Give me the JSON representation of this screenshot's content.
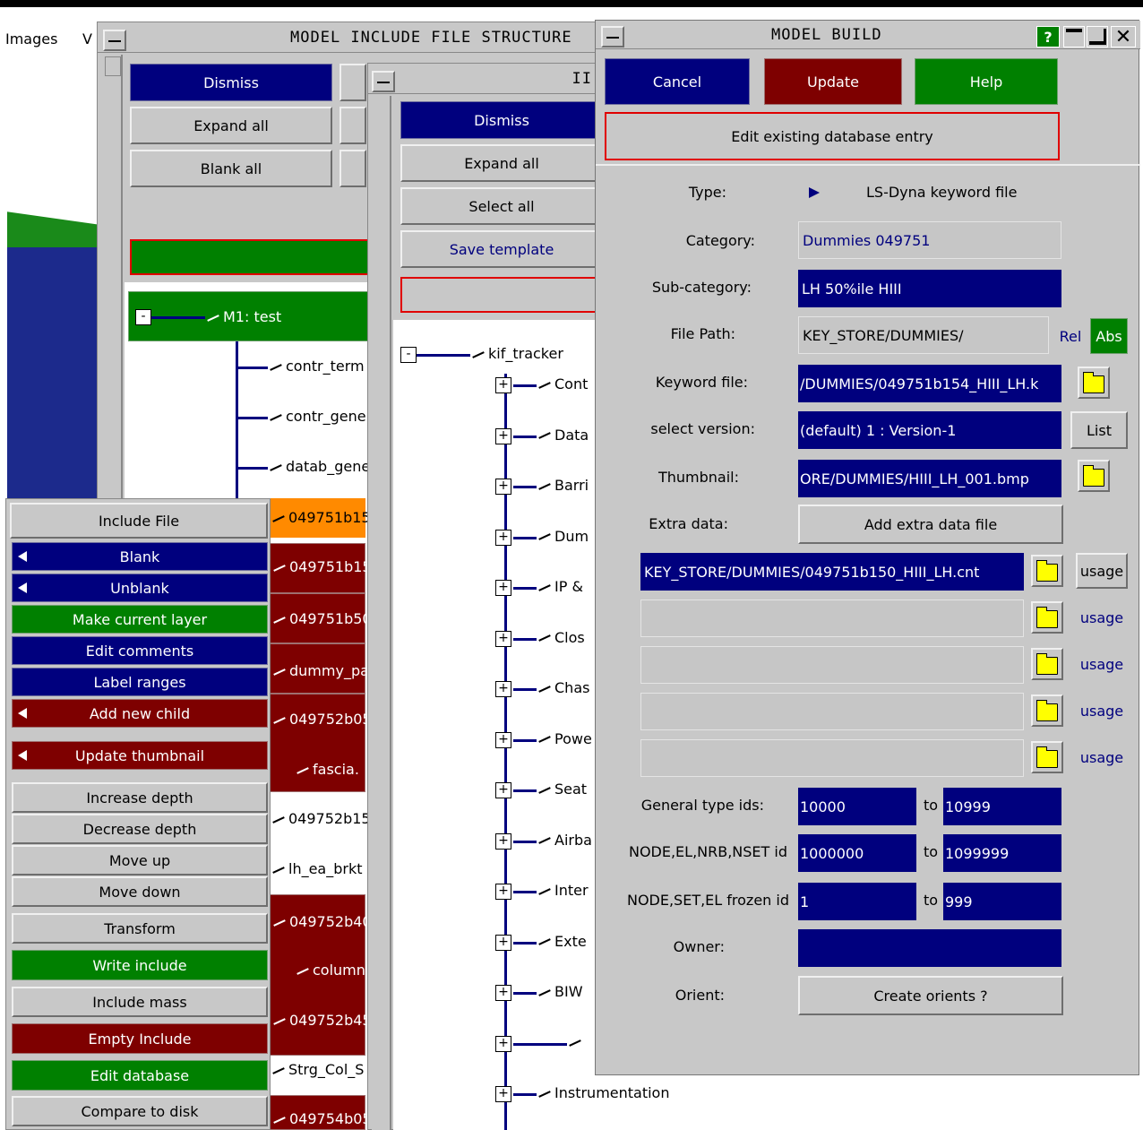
{
  "top_menu": {
    "images": "Images",
    "v": "V"
  },
  "mifs": {
    "title": "MODEL INCLUDE FILE STRUCTURE",
    "dismiss": "Dismiss",
    "expand_all": "Expand all",
    "blank_all": "Blank all",
    "root": "M1: test",
    "rows": [
      "contr_term",
      "contr_gene",
      "datab_gene",
      "049751b15",
      "049751b15",
      "049751b50",
      "dummy_pa",
      "049752b05",
      "fascia.",
      "049752b15",
      "lh_ea_brkt",
      "049752b40",
      "column",
      "049752b45",
      "Strg_Col_S",
      "049754b05"
    ]
  },
  "context_menu": {
    "title": "Include File",
    "items": [
      "Blank",
      "Unblank",
      "Make current layer",
      "Edit comments",
      "Label ranges",
      "Add new child",
      "Update thumbnail",
      "Increase depth",
      "Decrease depth",
      "Move up",
      "Move down",
      "Transform",
      "Write include",
      "Include mass",
      "Empty Include",
      "Edit database",
      "Compare to disk"
    ]
  },
  "kif": {
    "title_fragment": "II",
    "dismiss": "Dismiss",
    "expand_all": "Expand all",
    "select_all": "Select all",
    "save_template": "Save template",
    "root": "kif_tracker",
    "children": [
      "Cont",
      "Data",
      "Barri",
      "Dum",
      "IP &",
      "Clos",
      "Chas",
      "Powe",
      "Seat",
      "Airba",
      "Inter",
      "Exte",
      "BIW",
      "",
      "Instrumentation"
    ]
  },
  "model_build": {
    "title": "MODEL BUILD",
    "help_icon": "?",
    "cancel": "Cancel",
    "update": "Update",
    "help": "Help",
    "mode": "Edit existing database entry",
    "type_label": "Type:",
    "type_value": "LS-Dyna keyword file",
    "category_label": "Category:",
    "category_value": "Dummies 049751",
    "subcategory_label": "Sub-category:",
    "subcategory_value": "LH 50%ile HIII",
    "filepath_label": "File Path:",
    "filepath_value": "KEY_STORE/DUMMIES/",
    "rel": "Rel",
    "abs": "Abs",
    "keyword_label": "Keyword file:",
    "keyword_value": "/DUMMIES/049751b154_HIII_LH.k",
    "version_label": "select version:",
    "version_value": "(default) 1 : Version-1",
    "list": "List",
    "thumbnail_label": "Thumbnail:",
    "thumbnail_value": "ORE/DUMMIES/HIII_LH_001.bmp",
    "extra_label": "Extra data:",
    "add_extra": "Add extra data file",
    "extra_files": [
      "KEY_STORE/DUMMIES/049751b150_HIII_LH.cnt",
      "",
      "",
      "",
      ""
    ],
    "usage": "usage",
    "general_label": "General type ids:",
    "general_from": "10000",
    "general_to": "10999",
    "node_label": "NODE,EL,NRB,NSET id",
    "node_from": "1000000",
    "node_to": "1099999",
    "frozen_label": "NODE,SET,EL frozen id",
    "frozen_from": "1",
    "frozen_to": "999",
    "to": "to",
    "owner_label": "Owner:",
    "owner_value": "",
    "orient_label": "Orient:",
    "create_orients": "Create orients ?"
  },
  "colors": {
    "blue": "#00007e",
    "red": "#7e0000",
    "green": "#008000",
    "orange": "#ff8a00",
    "grey": "#c8c8c8"
  }
}
